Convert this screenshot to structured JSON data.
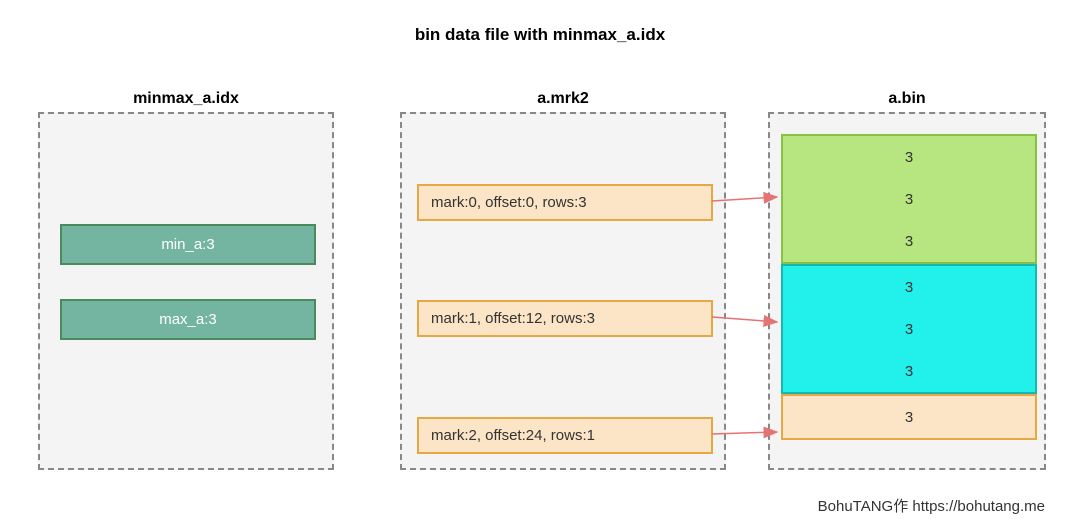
{
  "title": "bin data file with minmax_a.idx",
  "idx": {
    "label": "minmax_a.idx",
    "min": "min_a:3",
    "max": "max_a:3"
  },
  "mrk": {
    "label": "a.mrk2",
    "rows": [
      "mark:0, offset:0,  rows:3",
      "mark:1, offset:12,  rows:3",
      "mark:2, offset:24,  rows:1"
    ]
  },
  "bin": {
    "label": "a.bin",
    "blocks": [
      {
        "color": "green",
        "values": [
          "3",
          "3",
          "3"
        ]
      },
      {
        "color": "cyan",
        "values": [
          "3",
          "3",
          "3"
        ]
      },
      {
        "color": "cream",
        "values": [
          "3"
        ]
      }
    ]
  },
  "footer": "BohuTANG作 https://bohutang.me"
}
